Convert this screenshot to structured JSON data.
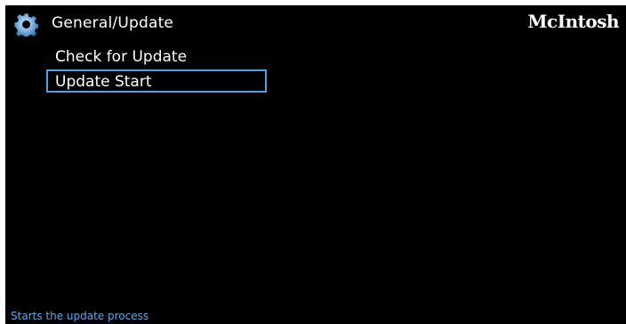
{
  "header": {
    "icon": "gear-icon",
    "title": "General/Update",
    "brand": "McIntosh"
  },
  "menu": {
    "items": [
      {
        "label": "Check for Update",
        "selected": false
      },
      {
        "label": "Update Start",
        "selected": true
      }
    ]
  },
  "status": {
    "text": "Starts the update process"
  },
  "colors": {
    "background": "#000000",
    "text": "#ffffff",
    "accent": "#4aa3e8",
    "status_text": "#5ea8e6",
    "icon": "#6fa8dc"
  }
}
